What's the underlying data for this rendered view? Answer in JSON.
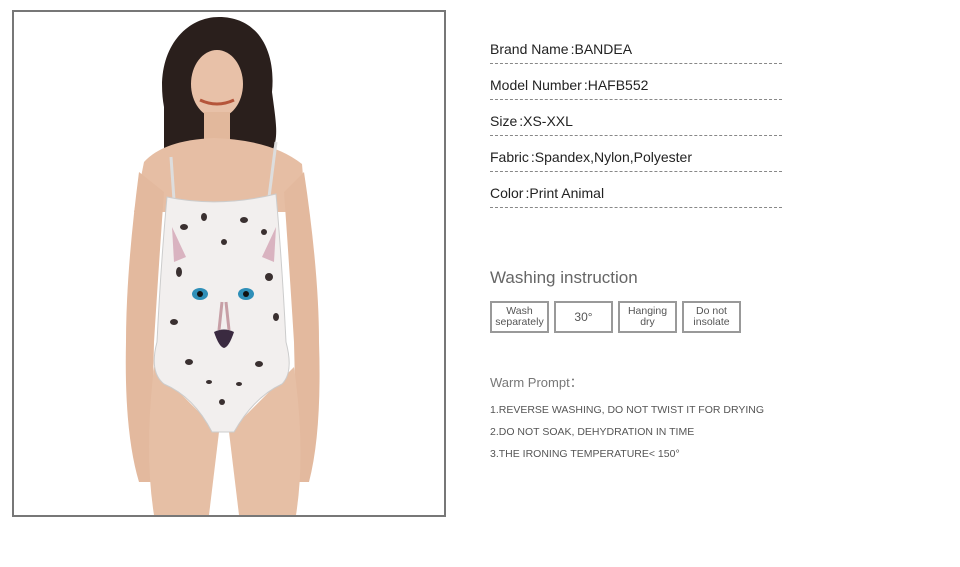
{
  "product_image": {
    "alt": "model wearing white leopard print swimsuit"
  },
  "specs": [
    {
      "label": "Brand Name",
      "sep": ":",
      "value": "BANDEA"
    },
    {
      "label": "Model Number",
      "sep": ":",
      "value": "HAFB552"
    },
    {
      "label": "Size",
      "sep": ":",
      "value": "XS-XXL"
    },
    {
      "label": "Fabric",
      "sep": ":",
      "value": "Spandex,Nylon,Polyester"
    },
    {
      "label": "Color",
      "sep": " : ",
      "value": "Print Animal"
    }
  ],
  "washing": {
    "title": "Washing instruction",
    "icons": [
      {
        "text": "Wash\nseparately"
      },
      {
        "text": "30°"
      },
      {
        "text": "Hanging\ndry"
      },
      {
        "text": "Do not\ninsolate"
      }
    ]
  },
  "warm_prompt": {
    "title": "Warm Prompt：",
    "items": [
      "1.REVERSE WASHING, DO NOT TWIST IT FOR DRYING",
      "2.DO NOT SOAK, DEHYDRATION IN TIME",
      "3.THE IRONING TEMPERATURE< 150°"
    ]
  },
  "colors": {
    "border": "#777777",
    "dashed": "#888888",
    "text": "#222222",
    "muted": "#666666"
  }
}
